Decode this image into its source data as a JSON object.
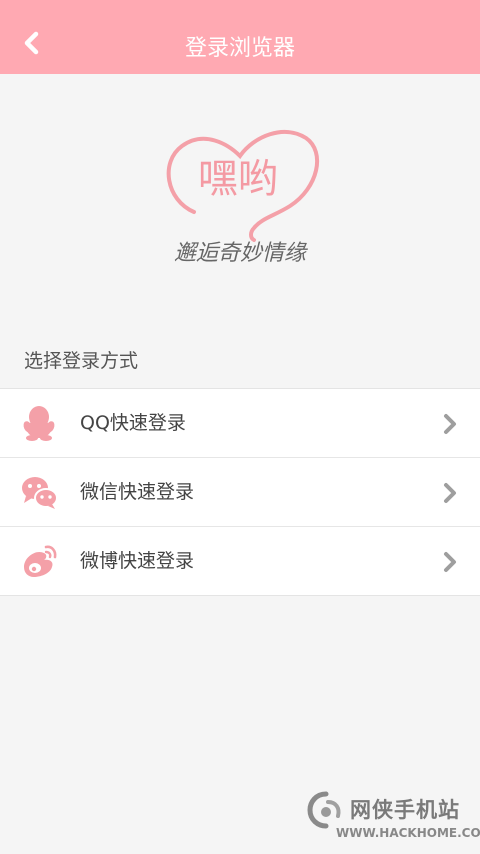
{
  "header": {
    "title": "登录浏览器",
    "back_icon": "chevron-left-icon"
  },
  "logo": {
    "title": "嘿哟",
    "slogan": "邂逅奇妙情缘"
  },
  "section": {
    "label": "选择登录方式"
  },
  "login_options": [
    {
      "label": "QQ快速登录",
      "icon": "qq-icon"
    },
    {
      "label": "微信快速登录",
      "icon": "wechat-icon"
    },
    {
      "label": "微博快速登录",
      "icon": "weibo-icon"
    }
  ],
  "watermark": {
    "name": "网侠手机站",
    "url": "WWW.HACKHOME.COM"
  },
  "colors": {
    "accent": "#ffa9b2",
    "icon_pink": "#f4a0a8",
    "chevron": "#9e9e9e",
    "background": "#f5f5f5"
  }
}
